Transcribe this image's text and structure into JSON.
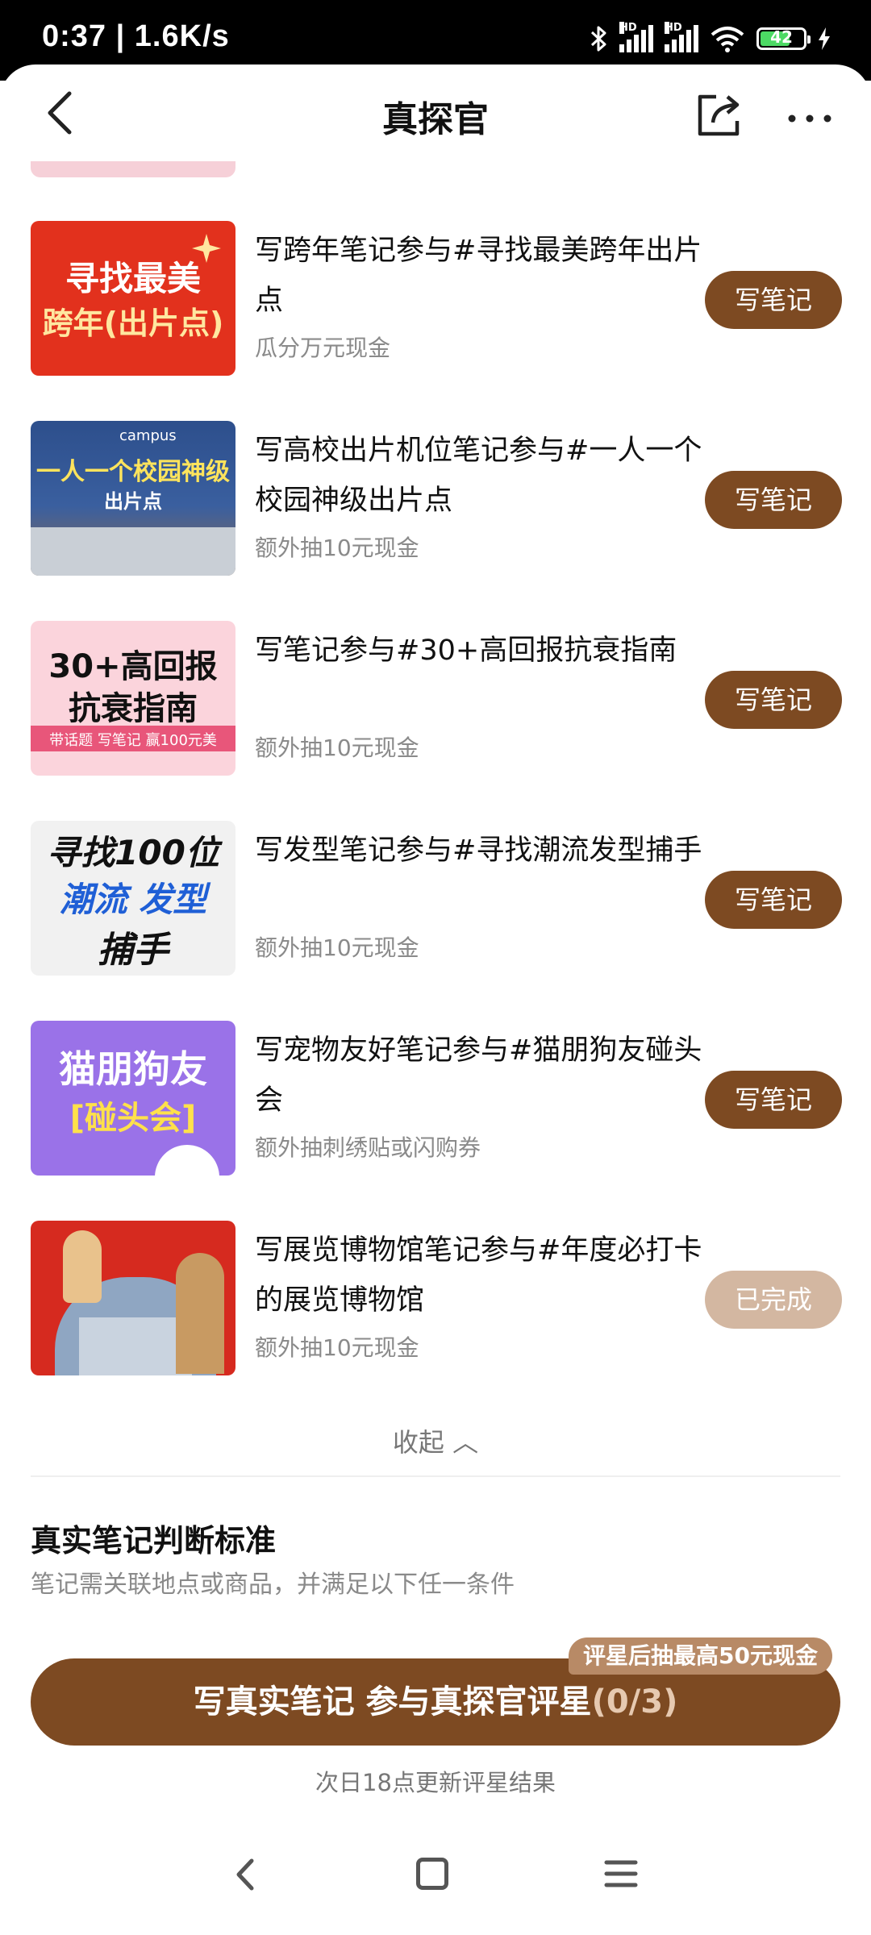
{
  "status_bar": {
    "time": "0:37 | 1.6K/s",
    "hd1": "HD",
    "hd2": "HD",
    "battery": "42",
    "icons": [
      "bluetooth-icon",
      "signal-icon",
      "signal-icon",
      "wifi-icon",
      "battery-icon",
      "charging-icon"
    ]
  },
  "navbar": {
    "title": "真探官",
    "icons": [
      "back-icon",
      "share-icon",
      "more-icon"
    ]
  },
  "tasks": [
    {
      "title": "写跨年笔记参与#寻找最美跨年出片点",
      "subtitle": "瓜分万元现金",
      "button": "写笔记",
      "status": "active",
      "thumb_lines": [
        "寻找最美",
        "跨年(出片点)"
      ]
    },
    {
      "title": "写高校出片机位笔记参与#一人一个校园神级出片点",
      "subtitle": "额外抽10元现金",
      "button": "写笔记",
      "status": "active",
      "thumb_lines": [
        "campus",
        "一人一个校园神级",
        "出片点"
      ]
    },
    {
      "title": "写笔记参与#30+高回报抗衰指南",
      "subtitle": "额外抽10元现金",
      "button": "写笔记",
      "status": "active",
      "thumb_lines": [
        "30+高回报",
        "抗衰指南",
        "带话题 写笔记 赢100元美"
      ]
    },
    {
      "title": "写发型笔记参与#寻找潮流发型捕手",
      "subtitle": "额外抽10元现金",
      "button": "写笔记",
      "status": "active",
      "thumb_lines": [
        "寻找100位",
        "潮流 发型",
        "捕手"
      ]
    },
    {
      "title": "写宠物友好笔记参与#猫朋狗友碰头会",
      "subtitle": "额外抽刺绣贴或闪购券",
      "button": "写笔记",
      "status": "active",
      "thumb_lines": [
        "猫朋狗友",
        "[碰头会]"
      ]
    },
    {
      "title": "写展览博物馆笔记参与#年度必打卡的展览博物馆",
      "subtitle": "额外抽10元现金",
      "button": "已完成",
      "status": "done",
      "thumb_lines": []
    }
  ],
  "collapse_label": "收起 ︿",
  "criteria": {
    "title": "真实笔记判断标准",
    "subtitle": "笔记需关联地点或商品，并满足以下任一条件"
  },
  "cta": {
    "label": "写真实笔记 参与真探官评星",
    "count": "(0/3)",
    "badge": "评星后抽最高50元现金",
    "note": "次日18点更新评星结果"
  },
  "colors": {
    "brand_brown": "#7d4a22",
    "done_button": "#d3b7a1",
    "subtitle_gray": "#8a8a8a"
  },
  "system_nav": [
    "back-icon",
    "home-icon",
    "menu-icon"
  ]
}
